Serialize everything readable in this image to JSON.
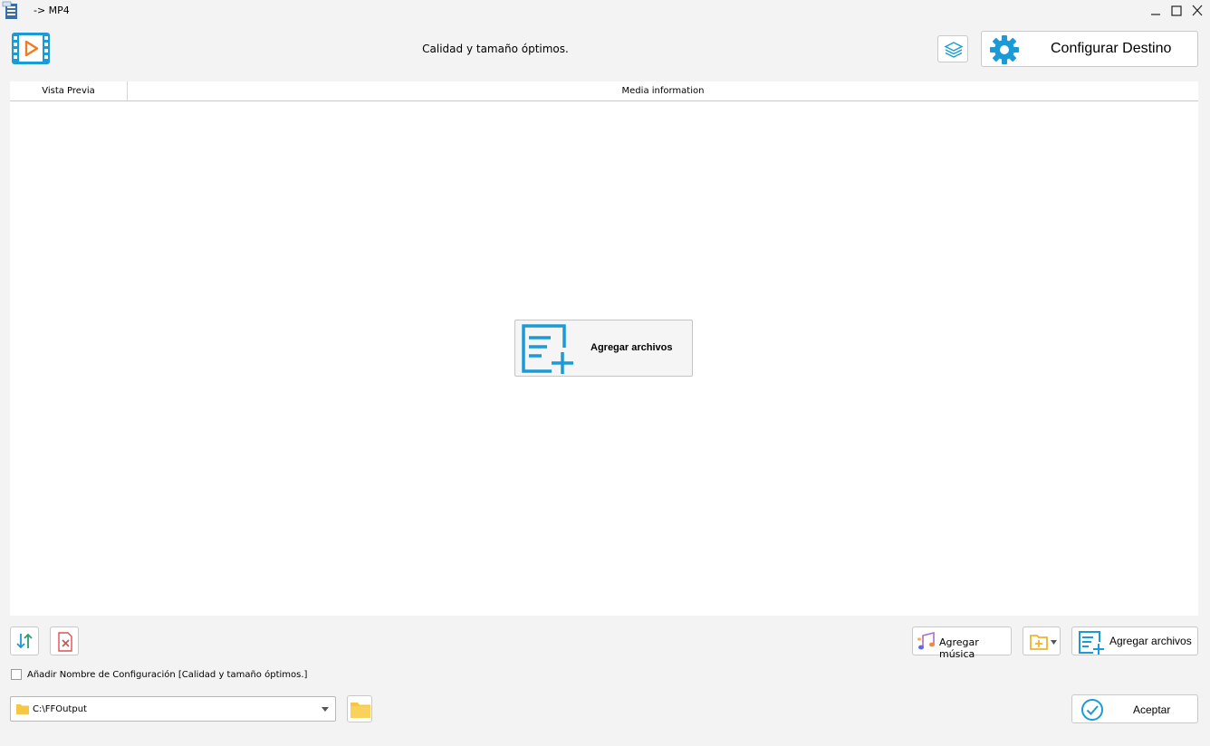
{
  "window": {
    "title": "-> MP4"
  },
  "header": {
    "description": "Calidad y tamaño óptimos.",
    "config_button_label": "Configurar Destino"
  },
  "list": {
    "columns": [
      "Vista Previa",
      "Media information"
    ],
    "add_files_label": "Agregar archivos"
  },
  "bottom": {
    "add_music_label": "Agregar música",
    "add_files_label": "Agregar archivos",
    "checkbox_label": "Añadir Nombre de Configuración [Calidad y tamaño óptimos.]",
    "checkbox_checked": false,
    "output_path": "C:\\FFOutput",
    "accept_label": "Aceptar"
  },
  "colors": {
    "accent": "#1a9ad6",
    "folder": "#f6c744",
    "remove": "#e05050"
  },
  "icons": [
    "app-icon",
    "video-logo-icon",
    "layers-icon",
    "gear-icon",
    "add-files-icon",
    "sort-icon",
    "remove-icon",
    "music-icon",
    "add-folder-icon",
    "folder-icon",
    "check-circle-icon",
    "dropdown-arrow-icon",
    "minimize-icon",
    "maximize-icon",
    "close-icon"
  ]
}
